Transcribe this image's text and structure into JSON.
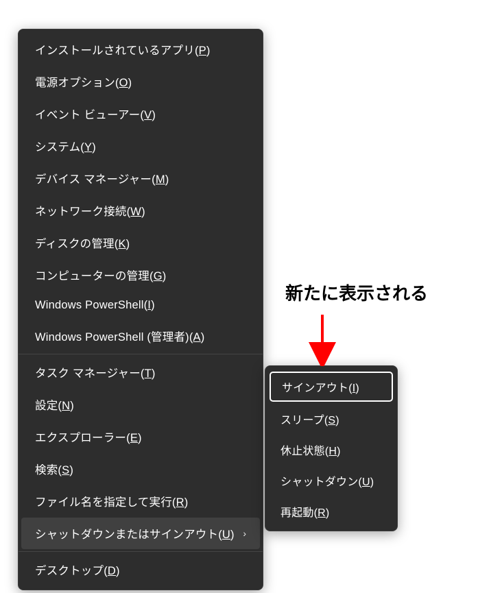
{
  "mainMenu": {
    "sections": [
      {
        "items": [
          {
            "text": "インストールされているアプリ",
            "key": "P"
          },
          {
            "text": "電源オプション",
            "key": "O"
          },
          {
            "text": "イベント ビューアー",
            "key": "V"
          },
          {
            "text": "システム",
            "key": "Y"
          },
          {
            "text": "デバイス マネージャー",
            "key": "M"
          },
          {
            "text": "ネットワーク接続",
            "key": "W"
          },
          {
            "text": "ディスクの管理",
            "key": "K"
          },
          {
            "text": "コンピューターの管理",
            "key": "G"
          },
          {
            "text": "Windows PowerShell",
            "key": "I"
          },
          {
            "text": "Windows PowerShell (管理者)",
            "key": "A"
          }
        ]
      },
      {
        "items": [
          {
            "text": "タスク マネージャー",
            "key": "T"
          },
          {
            "text": "設定",
            "key": "N"
          },
          {
            "text": "エクスプローラー",
            "key": "E"
          },
          {
            "text": "検索",
            "key": "S"
          },
          {
            "text": "ファイル名を指定して実行",
            "key": "R"
          },
          {
            "text": "シャットダウンまたはサインアウト",
            "key": "U",
            "hasSubmenu": true,
            "highlighted": true
          }
        ]
      },
      {
        "items": [
          {
            "text": "デスクトップ",
            "key": "D"
          }
        ]
      }
    ]
  },
  "submenu": {
    "items": [
      {
        "text": "サインアウト",
        "key": "I",
        "selected": true
      },
      {
        "text": "スリープ",
        "key": "S"
      },
      {
        "text": "休止状態",
        "key": "H"
      },
      {
        "text": "シャットダウン",
        "key": "U"
      },
      {
        "text": "再起動",
        "key": "R"
      }
    ]
  },
  "annotation": {
    "text": "新たに表示される"
  }
}
